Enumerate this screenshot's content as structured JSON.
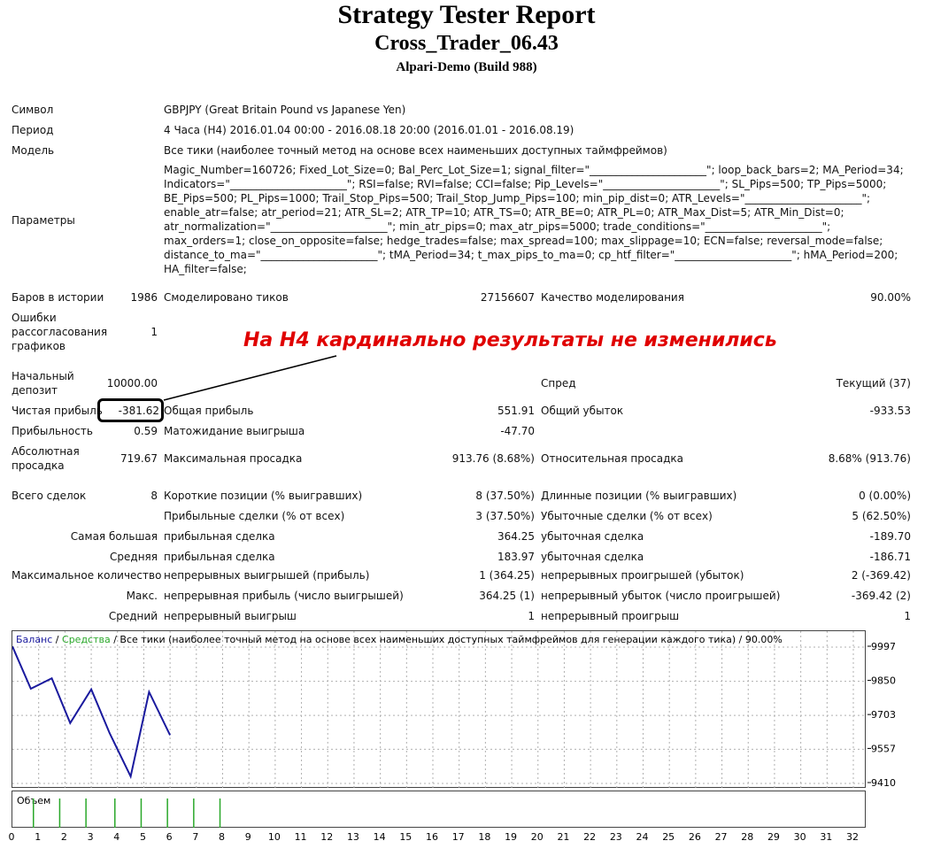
{
  "header": {
    "title": "Strategy Tester Report",
    "subtitle": "Cross_Trader_06.43",
    "server": "Alpari-Demo (Build 988)"
  },
  "info": {
    "symbol_label": "Символ",
    "symbol_value": "GBPJPY (Great Britain Pound vs Japanese Yen)",
    "period_label": "Период",
    "period_value": "4 Часа (H4) 2016.01.04 00:00 - 2016.08.18 20:00 (2016.01.01 - 2016.08.19)",
    "model_label": "Модель",
    "model_value": "Все тики (наиболее точный метод на основе всех наименьших доступных таймфреймов)",
    "params_label": "Параметры",
    "params_lines": [
      "Magic_Number=160726; Fixed_Lot_Size=0; Bal_Perc_Lot_Size=1; signal_filter=\"______________________\"; loop_back_bars=2; MA_Period=34;",
      "Indicators=\"______________________\"; RSI=false; RVI=false; CCI=false; Pip_Levels=\"______________________\"; SL_Pips=500; TP_Pips=5000;",
      "BE_Pips=500; PL_Pips=1000; Trail_Stop_Pips=500; Trail_Stop_Jump_Pips=100; min_pip_dist=0; ATR_Levels=\"______________________\";",
      "enable_atr=false; atr_period=21; ATR_SL=2; ATR_TP=10; ATR_TS=0; ATR_BE=0; ATR_PL=0; ATR_Max_Dist=5; ATR_Min_Dist=0;",
      "atr_normalization=\"______________________\"; min_atr_pips=0; max_atr_pips=5000; trade_conditions=\"______________________\";",
      "max_orders=1; close_on_opposite=false; hedge_trades=false; max_spread=100; max_slippage=10; ECN=false; reversal_mode=false;",
      "distance_to_ma=\"______________________\"; tMA_Period=34; t_max_pips_to_ma=0; cp_htf_filter=\"______________________\"; hMA_Period=200;",
      "HA_filter=false;"
    ]
  },
  "stats": {
    "bars_label": "Баров в истории",
    "bars_value": "1986",
    "ticks_label": "Смоделировано тиков",
    "ticks_value": "27156607",
    "quality_label": "Качество моделирования",
    "quality_value": "90.00%",
    "mismatch_label_1": "Ошибки",
    "mismatch_label_2": "рассогласования",
    "mismatch_label_3": "графиков",
    "mismatch_value": "1",
    "deposit_label_1": "Начальный",
    "deposit_label_2": "депозит",
    "deposit_value": "10000.00",
    "spread_label": "Спред",
    "spread_value": "Текущий (37)",
    "net_label": "Чистая прибыль",
    "net_value": "-381.62",
    "gross_profit_label": "Общая прибыль",
    "gross_profit_value": "551.91",
    "gross_loss_label": "Общий убыток",
    "gross_loss_value": "-933.53",
    "pf_label": "Прибыльность",
    "pf_value": "0.59",
    "payoff_label": "Матожидание выигрыша",
    "payoff_value": "-47.70",
    "abs_dd_label_1": "Абсолютная",
    "abs_dd_label_2": "просадка",
    "abs_dd_value": "719.67",
    "max_dd_label": "Максимальная просадка",
    "max_dd_value": "913.76 (8.68%)",
    "rel_dd_label": "Относительная просадка",
    "rel_dd_value": "8.68% (913.76)",
    "total_label": "Всего сделок",
    "total_value": "8",
    "short_label": "Короткие позиции (% выигравших)",
    "short_value": "8 (37.50%)",
    "long_label": "Длинные позиции (% выигравших)",
    "long_value": "0 (0.00%)",
    "profit_trades_label": "Прибыльные сделки (% от всех)",
    "profit_trades_value": "3 (37.50%)",
    "loss_trades_label": "Убыточные сделки (% от всех)",
    "loss_trades_value": "5 (62.50%)",
    "largest_label": "Самая большая",
    "largest_profit_label": "прибыльная сделка",
    "largest_profit_value": "364.25",
    "largest_loss_label": "убыточная сделка",
    "largest_loss_value": "-189.70",
    "avg_label": "Средняя",
    "avg_profit_label": "прибыльная сделка",
    "avg_profit_value": "183.97",
    "avg_loss_label": "убыточная сделка",
    "avg_loss_value": "-186.71",
    "maxcount_label": "Максимальное количество",
    "consec_wins_label": "непрерывных выигрышей (прибыль)",
    "consec_wins_value": "1 (364.25)",
    "consec_losses_label": "непрерывных проигрышей (убыток)",
    "consec_losses_value": "2 (-369.42)",
    "max_label": "Макс.",
    "consec_profit_label": "непрерывная прибыль (число выигрышей)",
    "consec_profit_value": "364.25 (1)",
    "consec_loss_label": "непрерывный убыток (число проигрышей)",
    "consec_loss_value": "-369.42 (2)",
    "avg2_label": "Средний",
    "avg_consec_wins_label": "непрерывный выигрыш",
    "avg_consec_wins_value": "1",
    "avg_consec_losses_label": "непрерывный проигрыш",
    "avg_consec_losses_value": "1"
  },
  "annotation": "На Н4 кардинально результаты не изменились",
  "chart_data": {
    "type": "line",
    "legend": {
      "balance": "Баланс",
      "sep1": " / ",
      "equity": "Средства",
      "rest": " / Все тики (наиболее точный метод на основе всех наименьших доступных таймфреймов для генерации каждого тика) / 90.00%"
    },
    "x": [
      0,
      0.7,
      1.5,
      2.2,
      3.0,
      3.7,
      4.5,
      5.2,
      6.0,
      6.7
    ],
    "y": [
      10000,
      9818,
      9863,
      9670,
      9815,
      9627,
      9440,
      9804,
      9618,
      9618
    ],
    "x_draw_count": 9,
    "y_ticks": [
      "9997",
      "9850",
      "9703",
      "9557",
      "9410"
    ],
    "ylim": [
      9410,
      9997
    ],
    "x_ticks": [
      "0",
      "1",
      "2",
      "3",
      "4",
      "5",
      "6",
      "7",
      "8",
      "9",
      "10",
      "11",
      "12",
      "13",
      "14",
      "15",
      "16",
      "17",
      "18",
      "19",
      "20",
      "21",
      "22",
      "23",
      "24",
      "25",
      "26",
      "27",
      "28",
      "29",
      "30",
      "31",
      "32"
    ],
    "xlim": [
      0,
      32
    ],
    "volume_label": "Объем",
    "volume_x": [
      0.8,
      1.8,
      2.8,
      3.9,
      4.9,
      5.9,
      6.9,
      7.9
    ],
    "colors": {
      "balance": "#1a1a9e",
      "equity": "#2aa82a",
      "volume": "#2aa82a",
      "grid": "#b0b0b0"
    }
  }
}
